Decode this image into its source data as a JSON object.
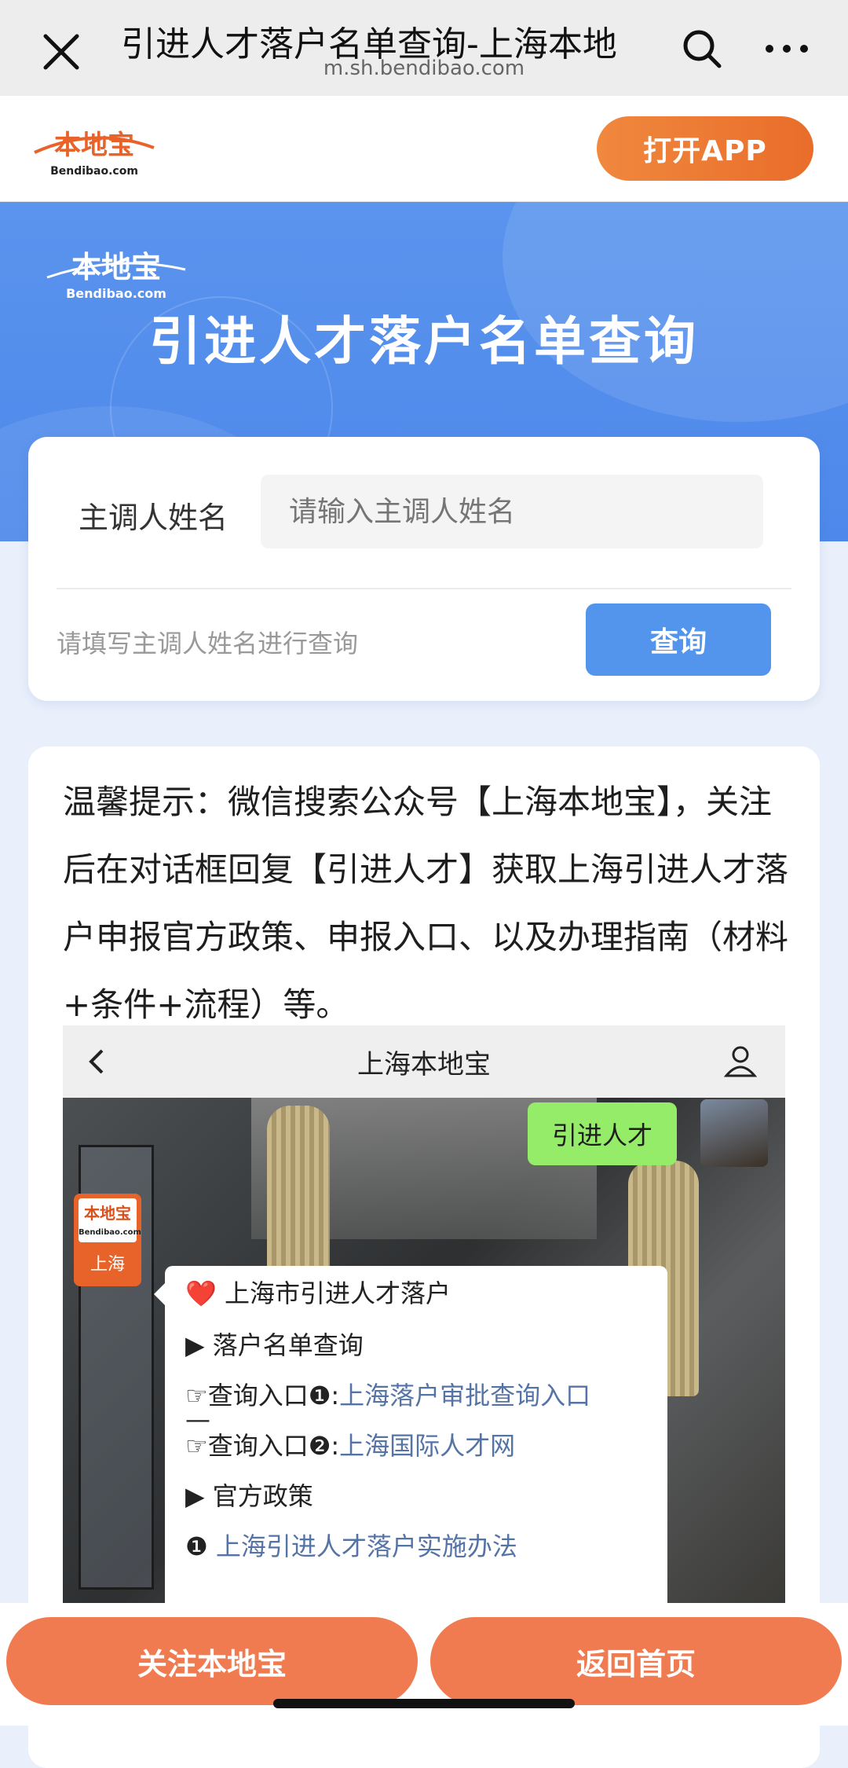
{
  "browser": {
    "title": "引进人才落户名单查询-上海本地",
    "url": "m.sh.bendibao.com"
  },
  "app_header": {
    "logo_text": "本地宝",
    "logo_sub": "Bendibao.com",
    "open_app_label": "打开APP"
  },
  "hero": {
    "logo_text": "本地宝",
    "logo_sub": "Bendibao.com",
    "title": "引进人才落户名单查询"
  },
  "search_form": {
    "field_label": "主调人姓名",
    "placeholder": "请输入主调人姓名",
    "hint": "请填写主调人姓名进行查询",
    "query_label": "查询"
  },
  "tip": {
    "text": "温馨提示：微信搜索公众号【上海本地宝】，关注后在对话框回复【引进人才】获取上海引进人才落户申报官方政策、申报入口、以及办理指南（材料+条件+流程）等。"
  },
  "chat_image": {
    "account_name": "上海本地宝",
    "user_message": "引进人才",
    "bot_avatar_top": "本地宝",
    "bot_avatar_sub": "Bendibao.com",
    "bot_avatar_city": "上海",
    "reply": {
      "heading": "上海市引进人才落户",
      "section1": "▶ 落户名单查询",
      "entry1_prefix": "☞查询入口❶:",
      "entry1_link": "上海落户审批查询入口",
      "entry1_tail": "—",
      "entry2_prefix": "☞查询入口❷:",
      "entry2_link": "上海国际人才网",
      "section2": "▶ 官方政策",
      "policy1_num": "❶",
      "policy1_link": "上海引进人才落户实施办法"
    }
  },
  "bottom": {
    "follow_label": "关注本地宝",
    "home_label": "返回首页"
  }
}
